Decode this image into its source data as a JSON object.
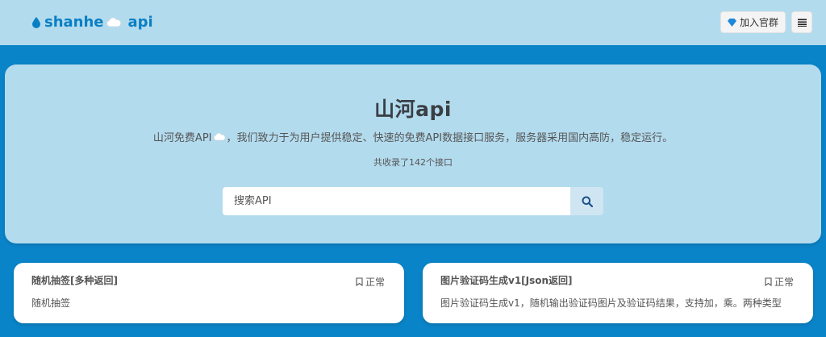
{
  "header": {
    "logo_part1": "shanhe",
    "logo_part2": "api",
    "join_label": "加入官群",
    "menu_icon": "hamburger-icon"
  },
  "hero": {
    "title": "山河api",
    "desc_before": "山河免费API",
    "desc_after": "，我们致力于为用户提供稳定、快速的免费API数据接口服务，服务器采用国内高防，稳定运行。",
    "count_text": "共收录了142个接口"
  },
  "search": {
    "placeholder": "搜索API",
    "icon": "search-icon"
  },
  "cards": [
    {
      "title": "随机抽签[多种返回]",
      "status": "正常",
      "desc": "随机抽签"
    },
    {
      "title": "图片验证码生成v1[Json返回]",
      "status": "正常",
      "desc": "图片验证码生成v1，随机输出验证码图片及验证码结果，支持加，乘。两种类型"
    }
  ],
  "colors": {
    "page_bg": "#0a84c8",
    "panel_bg": "#b3dbee",
    "brand": "#0a7fc4"
  }
}
